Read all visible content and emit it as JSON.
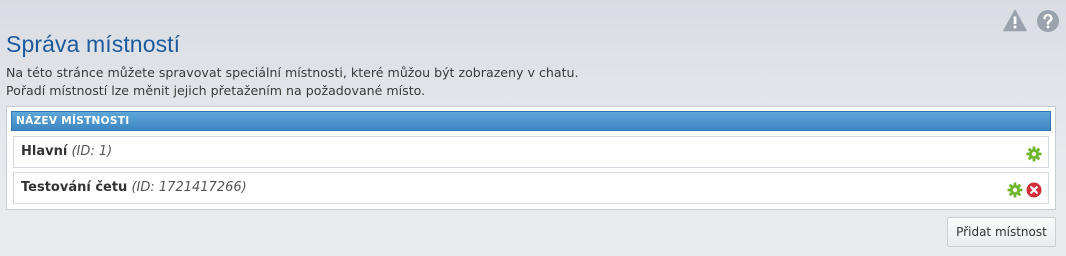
{
  "header": {
    "title": "Správa místností",
    "description_line1": "Na této stránce můžete spravovat speciální místnosti, které můžou být zobrazeny v chatu.",
    "description_line2": "Pořadí místností lze měnit jejich přetažením na požadované místo.",
    "icons": [
      "warning-icon",
      "help-icon"
    ]
  },
  "table": {
    "column_header": "NÁZEV MÍSTNOSTI",
    "rows": [
      {
        "name": "Hlavní",
        "id_text": "(ID: 1)",
        "actions": [
          "settings-icon"
        ]
      },
      {
        "name": "Testování četu",
        "id_text": "(ID: 1721417266)",
        "actions": [
          "settings-icon",
          "delete-icon"
        ]
      }
    ]
  },
  "actions": {
    "add_label": "Přidat místnost"
  },
  "colors": {
    "title": "#1d5a9c",
    "header_bar": "#3e86c2",
    "settings_icon": "#6fb52e",
    "delete_icon": "#d32f3a",
    "top_icons": "#9aa3ad"
  }
}
